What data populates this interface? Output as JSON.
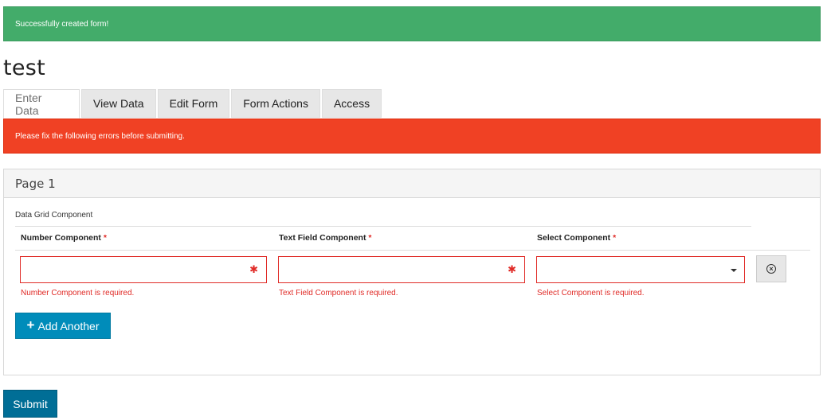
{
  "alerts": {
    "success": "Successfully created form!",
    "error": "Please fix the following errors before submitting."
  },
  "form": {
    "title": "test"
  },
  "tabs": [
    {
      "label": "Enter Data",
      "active": true
    },
    {
      "label": "View Data",
      "active": false
    },
    {
      "label": "Edit Form",
      "active": false
    },
    {
      "label": "Form Actions",
      "active": false
    },
    {
      "label": "Access",
      "active": false
    }
  ],
  "panel": {
    "title": "Page 1",
    "grid_label": "Data Grid Component",
    "columns": [
      {
        "label": "Number Component",
        "required_mark": "*",
        "value": "",
        "error": "Number Component is required."
      },
      {
        "label": "Text Field Component",
        "required_mark": "*",
        "value": "",
        "error": "Text Field Component is required."
      },
      {
        "label": "Select Component",
        "required_mark": "*",
        "value": "",
        "error": "Select Component is required."
      }
    ],
    "field_asterisk": "✱",
    "remove_icon": "⊗",
    "add_another_label": "Add Another"
  },
  "submit_label": "Submit",
  "colors": {
    "success": "#43ac6a",
    "danger": "#f04124",
    "primary": "#008cba",
    "submit": "#006e96",
    "error_text": "#e02b27"
  }
}
